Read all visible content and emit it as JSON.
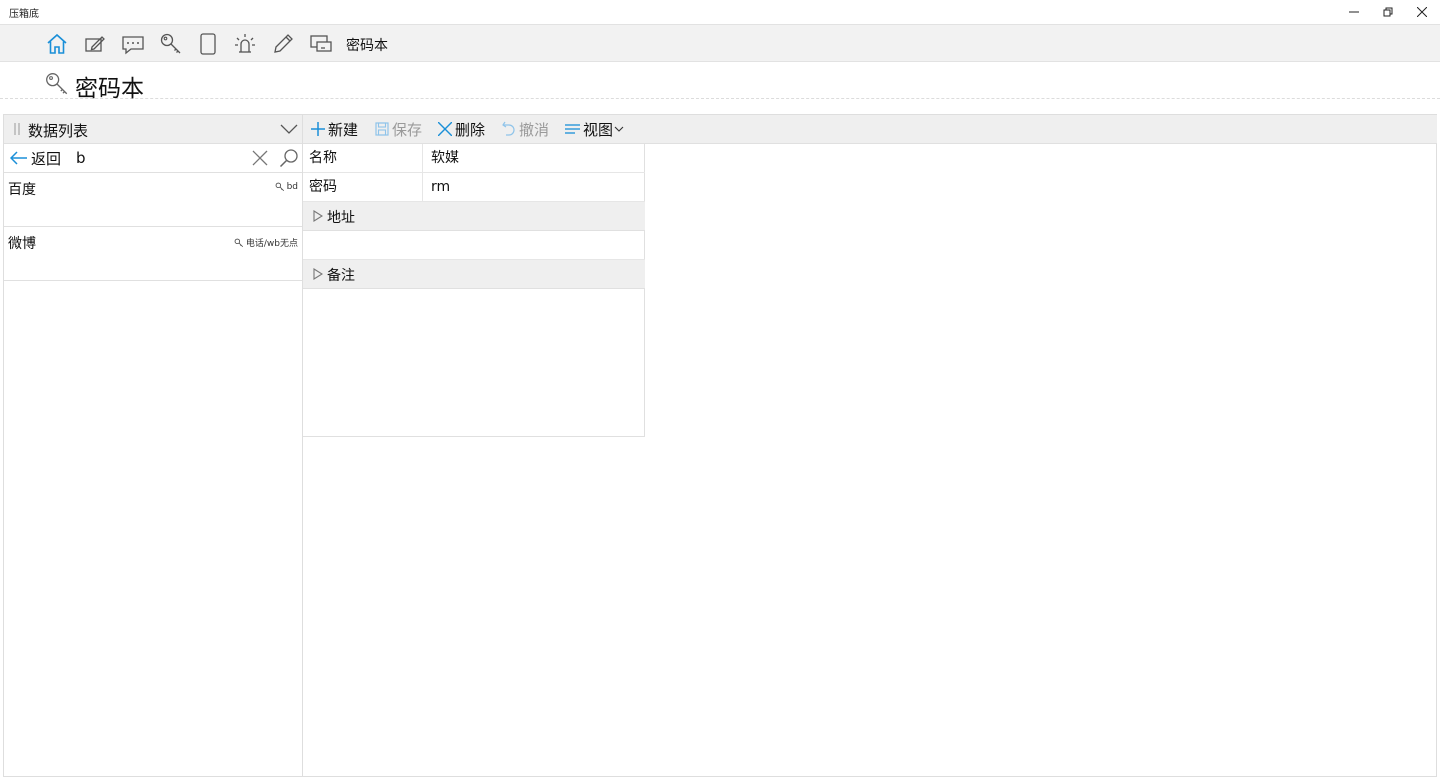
{
  "window": {
    "title": "压箱底"
  },
  "app_toolbar": {
    "icons": [
      "home-icon",
      "edit-note-icon",
      "chat-icon",
      "key-icon",
      "tablet-icon",
      "idea-bulb-icon",
      "pencil-icon",
      "device-icon"
    ],
    "current_label": "密码本"
  },
  "page": {
    "title": "密码本",
    "icon": "key-icon"
  },
  "left_panel": {
    "title": "数据列表",
    "back_label": "返回",
    "search_value": "b",
    "items": [
      {
        "name": "百度",
        "account": "bd"
      },
      {
        "name": "微博",
        "account": "电话/wb无点"
      }
    ]
  },
  "right_panel": {
    "toolbar": {
      "new_label": "新建",
      "save_label": "保存",
      "delete_label": "删除",
      "undo_label": "撤消",
      "view_label": "视图"
    },
    "fields": [
      {
        "label": "名称",
        "value": "软媒"
      },
      {
        "label": "密码",
        "value": "rm"
      }
    ],
    "sections": {
      "address_label": "地址",
      "notes_label": "备注"
    }
  },
  "colors": {
    "accent": "#1a8fd8",
    "disabled": "#9a9a9a",
    "panel_bg": "#efefef"
  }
}
